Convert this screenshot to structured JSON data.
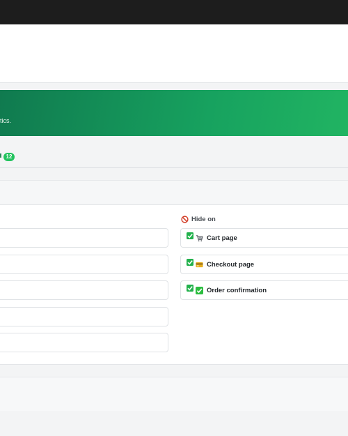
{
  "banner": {
    "description_fragment": "tistics."
  },
  "tabs": {
    "active_count": "12"
  },
  "hide_on": {
    "heading": "Hide on",
    "heading_icon": "prohibited-icon",
    "items": [
      {
        "label": "Cart page",
        "icon": "shopping-cart-icon",
        "checked": true
      },
      {
        "label": "Checkout page",
        "icon": "credit-card-icon",
        "checked": true
      },
      {
        "label": "Order confirmation",
        "icon": "check-mark-icon",
        "checked": true
      }
    ]
  },
  "colors": {
    "brand_green": "#17a25f",
    "badge_green": "#22c35e",
    "checkbox_green": "#22b14c",
    "topbar": "#1d1d1d"
  }
}
